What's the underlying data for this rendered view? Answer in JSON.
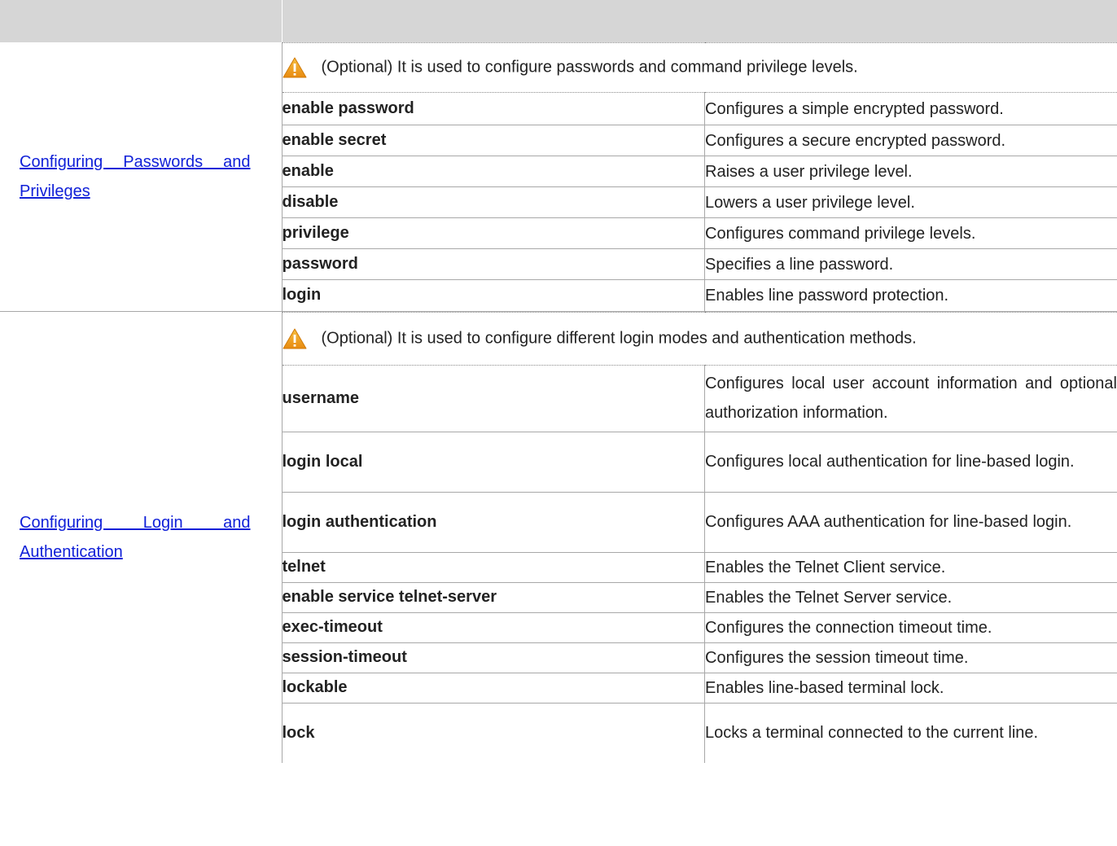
{
  "header": {
    "col1": "",
    "col2": ""
  },
  "groups": [
    {
      "task_label": "Configuring Passwords and Privileges",
      "note": "(Optional) It is used to configure passwords and command privilege levels.",
      "commands": [
        {
          "name": "enable password",
          "desc": "Configures a simple encrypted password."
        },
        {
          "name": "enable secret",
          "desc": "Configures a secure encrypted password."
        },
        {
          "name": "enable",
          "desc": "Raises a user privilege level."
        },
        {
          "name": "disable",
          "desc": "Lowers a user privilege level."
        },
        {
          "name": "privilege",
          "desc": "Configures command privilege levels."
        },
        {
          "name": "password",
          "desc": "Specifies a line password."
        },
        {
          "name": "login",
          "desc": "Enables line password protection."
        }
      ]
    },
    {
      "task_label": "Configuring Login and Authentication",
      "note": "(Optional) It is used to configure different login modes and authentication methods.",
      "commands": [
        {
          "name": "username",
          "desc": "Configures local user account information and optional authorization information."
        },
        {
          "name": "login local",
          "desc": "Configures local authentication for line-based login."
        },
        {
          "name": "login authentication",
          "desc": "Configures AAA authentication for line-based login."
        },
        {
          "name": "telnet",
          "desc": "Enables the Telnet Client service."
        },
        {
          "name": "enable service telnet-server",
          "desc": "Enables the Telnet Server service."
        },
        {
          "name": "exec-timeout",
          "desc": "Configures the connection timeout time."
        },
        {
          "name": "session-timeout",
          "desc": "Configures the session timeout time."
        },
        {
          "name": "lockable",
          "desc": "Enables line-based terminal lock."
        },
        {
          "name": "lock",
          "desc": "Locks a terminal connected to the current line."
        }
      ]
    }
  ],
  "colors": {
    "header_bg": "#d6d6d6",
    "link": "#1020d8",
    "warn": "#f0a020"
  },
  "icons": {
    "warning": "warning-icon"
  }
}
